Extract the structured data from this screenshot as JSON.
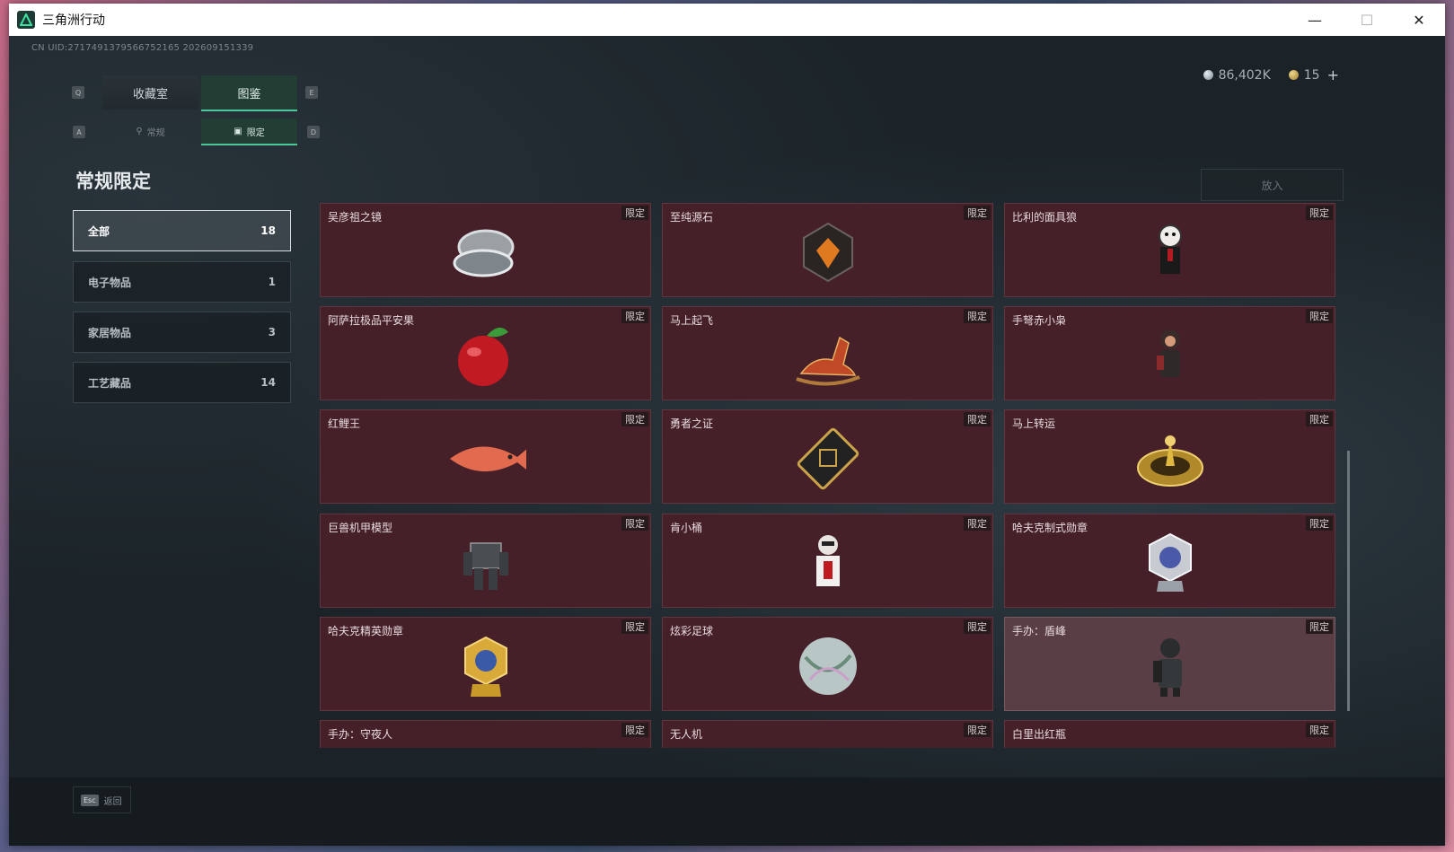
{
  "window": {
    "title": "三角洲行动",
    "minimize": "—",
    "maximize": "☐",
    "close": "✕"
  },
  "header": {
    "uid": "CN UID:2717491379566752165 202609151339"
  },
  "currency": {
    "silver": "86,402K",
    "gold": "15",
    "add": "+"
  },
  "tabs": {
    "key_left": "Q",
    "key_right": "E",
    "main": [
      {
        "label": "收藏室"
      },
      {
        "label": "图鉴"
      }
    ],
    "sub_key_left": "A",
    "sub_key_right": "D",
    "sub": [
      {
        "label": "常规"
      },
      {
        "label": "限定"
      }
    ]
  },
  "section_title": "常规限定",
  "sort_button": "放入",
  "categories": [
    {
      "label": "全部",
      "count": "18"
    },
    {
      "label": "电子物品",
      "count": "1"
    },
    {
      "label": "家居物品",
      "count": "3"
    },
    {
      "label": "工艺藏品",
      "count": "14"
    }
  ],
  "items": [
    {
      "name": "吴彦祖之镜",
      "badge": "限定",
      "icon": "mirror-icon"
    },
    {
      "name": "至纯源石",
      "badge": "限定",
      "icon": "gem-icon"
    },
    {
      "name": "比利的面具狼",
      "badge": "限定",
      "icon": "puppet-icon"
    },
    {
      "name": "阿萨拉极品平安果",
      "badge": "限定",
      "icon": "apple-icon"
    },
    {
      "name": "马上起飞",
      "badge": "限定",
      "icon": "horse-icon"
    },
    {
      "name": "手弩赤小枭",
      "badge": "限定",
      "icon": "figure-icon"
    },
    {
      "name": "红鲤王",
      "badge": "限定",
      "icon": "fish-icon"
    },
    {
      "name": "勇者之证",
      "badge": "限定",
      "icon": "card-icon"
    },
    {
      "name": "马上转运",
      "badge": "限定",
      "icon": "wheel-icon"
    },
    {
      "name": "巨兽机甲模型",
      "badge": "限定",
      "icon": "mech-icon"
    },
    {
      "name": "肯小桶",
      "badge": "限定",
      "icon": "bucket-icon"
    },
    {
      "name": "哈夫克制式勋章",
      "badge": "限定",
      "icon": "medal-silver-icon"
    },
    {
      "name": "哈夫克精英勋章",
      "badge": "限定",
      "icon": "medal-gold-icon"
    },
    {
      "name": "炫彩足球",
      "badge": "限定",
      "icon": "ball-icon"
    },
    {
      "name": "手办：盾峰",
      "badge": "限定",
      "icon": "figure-shield-icon"
    },
    {
      "name": "手办：守夜人",
      "badge": "限定",
      "icon": "figure-night-icon"
    },
    {
      "name": "无人机",
      "badge": "限定",
      "icon": "drone-icon"
    },
    {
      "name": "白里出红瓶",
      "badge": "限定",
      "icon": "vase-icon"
    }
  ],
  "footer": {
    "esc_key": "Esc",
    "back_label": "返回"
  }
}
